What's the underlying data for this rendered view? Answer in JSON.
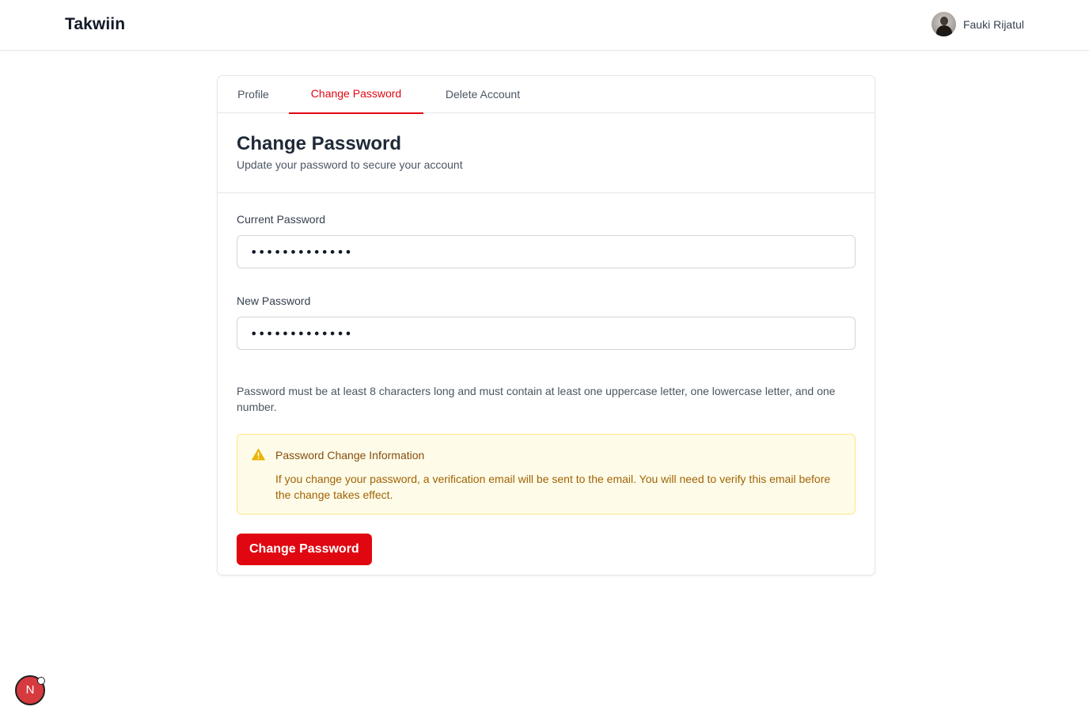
{
  "app": {
    "brand": "Takwiin"
  },
  "user": {
    "name": "Fauki Rijatul"
  },
  "tabs": [
    {
      "label": "Profile"
    },
    {
      "label": "Change Password",
      "active": true
    },
    {
      "label": "Delete Account"
    }
  ],
  "header": {
    "title": "Change Password",
    "subtitle": "Update your password to secure your account"
  },
  "form": {
    "current_password": {
      "label": "Current Password",
      "value": "•••••••••••••"
    },
    "new_password": {
      "label": "New Password",
      "value": "•••••••••••••"
    },
    "hint": "Password must be at least 8 characters long and must contain at least one uppercase letter, one lowercase letter, and one number."
  },
  "alert": {
    "icon": "warning-icon",
    "title": "Password Change Information",
    "body": "If you change your password, a verification email will be sent to the email. You will need to verify this email before the change takes effect."
  },
  "submit_label": "Change Password",
  "dev_badge": {
    "label": "N"
  },
  "colors": {
    "accent": "#e00711",
    "alert_bg": "#fefce8",
    "alert_title": "#854d0e",
    "alert_text": "#a16207"
  }
}
